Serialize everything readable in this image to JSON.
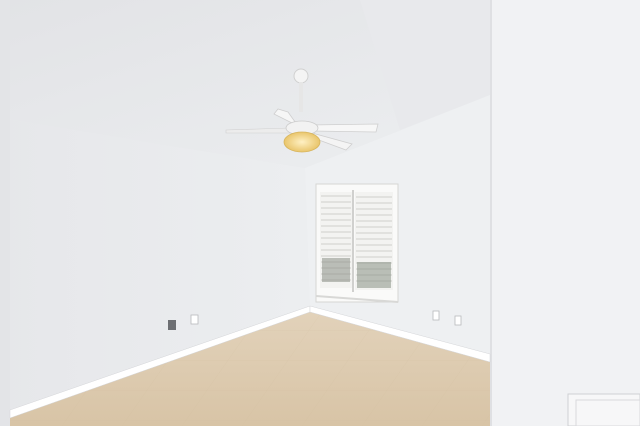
{
  "scene": {
    "description_type": "photograph",
    "colors": {
      "wall_left": "#e8e9eb",
      "wall_back": "#eeeff1",
      "wall_right": "#f0f1f3",
      "ceiling": "#e4e5e7",
      "floor": "#dcc9ad",
      "trim": "#ffffff",
      "light_glow": "#f3d68a",
      "shutter": "#f7f7f5"
    },
    "icons": [
      "ceiling-fan-icon",
      "window-shutter-icon",
      "outlet-icon",
      "floor-vent-icon"
    ]
  }
}
